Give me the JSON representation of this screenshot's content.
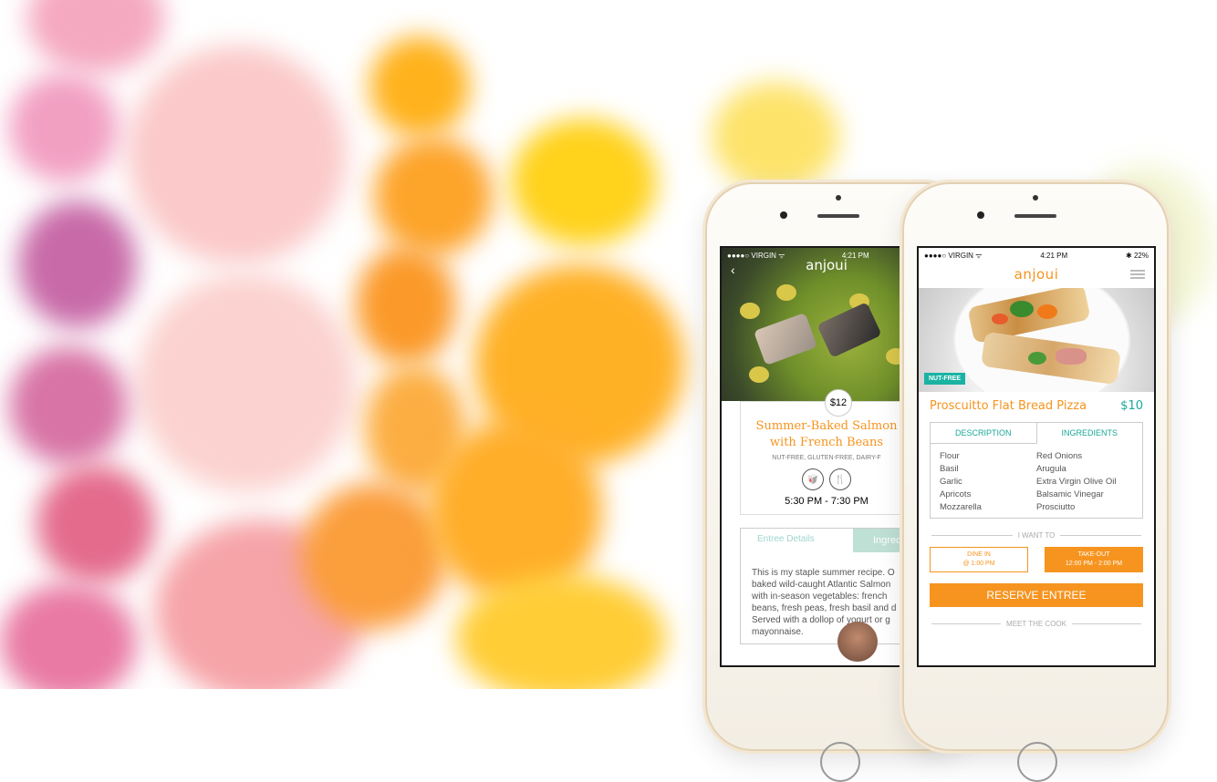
{
  "front_phone": {
    "status": {
      "carrier": "●●●●○ VIRGIN ᯤ",
      "time": "4:21 PM",
      "battery": "✱ 22%"
    },
    "logo": "anjoui",
    "badge": "NUT-FREE",
    "dish": {
      "title": "Proscuitto Flat Bread Pizza",
      "price": "$10"
    },
    "tabs": {
      "description": "DESCRIPTION",
      "ingredients": "INGREDIENTS"
    },
    "ingredients": [
      "Flour",
      "Red Onions",
      "Basil",
      "Arugula",
      "Garlic",
      "Extra Virgin Olive Oil",
      "Apricots",
      "Balsamic Vinegar",
      "Mozzarella",
      "Prosciutto"
    ],
    "want_to_label": "I WANT TO",
    "dine_in": {
      "line1": "DINE IN",
      "line2": "@ 1:00 PM"
    },
    "take_out": {
      "line1": "TAKE-OUT",
      "line2": "12:00 PM - 2:00 PM"
    },
    "reserve_label": "RESERVE ENTREE",
    "meet_cook_label": "MEET THE COOK"
  },
  "back_phone": {
    "status": {
      "carrier": "●●●●○ VIRGIN ᯤ",
      "time": "4:21 PM"
    },
    "logo": "anjoui",
    "back_arrow": "‹",
    "price": "$12",
    "dish_line1": "Summer-Baked Salmon",
    "dish_line2": "with French Beans",
    "tags": "NUT-FREE, GLUTEN-FREE, DAIRY-F",
    "time": "5:30 PM - 7:30 PM",
    "tab_entree": "Entree Details",
    "tab_ingredients": "Ingredien",
    "paragraph": [
      "This is my staple summer recipe. O",
      "baked wild-caught Atlantic Salmon",
      "with in-season vegetables: french",
      "beans, fresh peas, fresh basil and d",
      "Served with a dollop of yogurt or g",
      "mayonnaise."
    ]
  },
  "colors": {
    "accent_orange": "#f6941f",
    "accent_teal": "#1aa89a"
  }
}
